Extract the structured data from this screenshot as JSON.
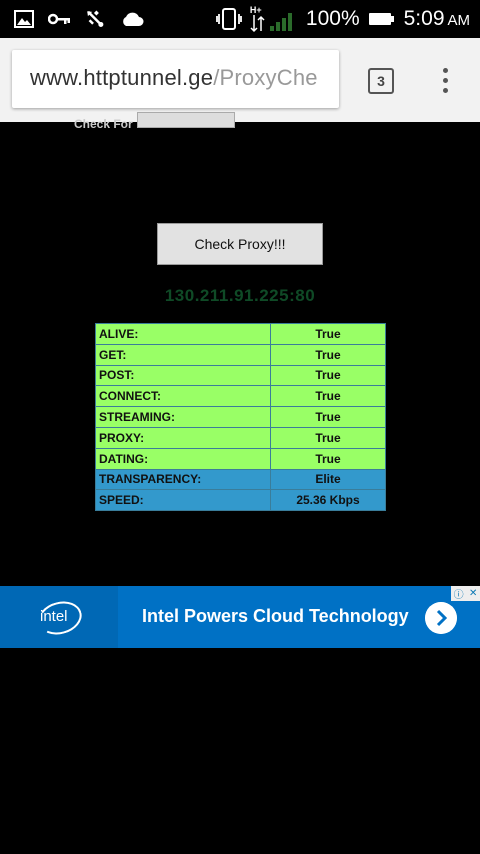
{
  "status_bar": {
    "network_label": "H+",
    "battery_percent": "100%",
    "time": "5:09",
    "ampm": "AM"
  },
  "browser": {
    "url_host": "www.httptunnel.ge",
    "url_path": "/ProxyChe",
    "tab_count": "3"
  },
  "page": {
    "cutoff_label": "Check For",
    "check_button": "Check Proxy!!!",
    "ip_address": "130.211.91.225:80",
    "results": [
      {
        "label": "ALIVE:",
        "value": "True",
        "color": "#99ff66"
      },
      {
        "label": "GET:",
        "value": "True",
        "color": "#99ff66"
      },
      {
        "label": "POST:",
        "value": "True",
        "color": "#99ff66"
      },
      {
        "label": "CONNECT:",
        "value": "True",
        "color": "#99ff66"
      },
      {
        "label": "STREAMING:",
        "value": "True",
        "color": "#99ff66"
      },
      {
        "label": "PROXY:",
        "value": "True",
        "color": "#99ff66"
      },
      {
        "label": "DATING:",
        "value": "True",
        "color": "#99ff66"
      },
      {
        "label": "TRANSPARENCY:",
        "value": "Elite",
        "color": "#3399cc"
      },
      {
        "label": "SPEED:",
        "value": "25.36 Kbps",
        "color": "#3399cc"
      }
    ]
  },
  "ad": {
    "brand": "intel",
    "title": "Intel Powers Cloud Technology",
    "brand_color": "#0071c5"
  },
  "icons": [
    "gallery-icon",
    "key-icon",
    "usb-icon",
    "cloud-icon",
    "vibrate-icon",
    "signal-icon",
    "battery-icon",
    "chevron-right-icon",
    "adchoices-icon",
    "close-icon"
  ]
}
